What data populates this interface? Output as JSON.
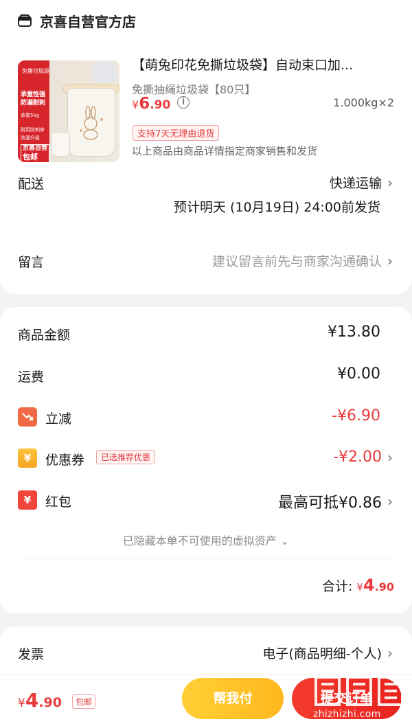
{
  "shop": {
    "icon": "store-icon",
    "name": "京喜自营官方店"
  },
  "product": {
    "image": {
      "banner_top": "免撕垃圾袋",
      "banner_line1": "承重性强",
      "banner_line2": "防漏耐刺",
      "small1": "承重5kg",
      "small2": "耐用防刺穿",
      "small3": "防漏升级",
      "badge_line1": "京喜自营",
      "badge_line2": "包邮"
    },
    "title": "【萌兔印花免撕垃圾袋】自动束口加...",
    "spec": "免撕抽绳垃圾袋【80只】",
    "price_symbol": "¥",
    "price_int": "6",
    "price_dec": ".90",
    "weight_qty": "1.000kg×2",
    "return_policy": "支持7天无理由退货",
    "seller_note": "以上商品由商品详情指定商家销售和发货"
  },
  "delivery": {
    "label": "配送",
    "method": "快递运输",
    "eta": "预计明天 (10月19日) 24:00前发货"
  },
  "message": {
    "label": "留言",
    "placeholder": "建议留言前先与商家沟通确认"
  },
  "amounts": {
    "goods_label": "商品金额",
    "goods_value": "¥13.80",
    "shipping_label": "运费",
    "shipping_value": "¥0.00",
    "discount_label": "立减",
    "discount_value": "-¥6.90",
    "coupon_label": "优惠券",
    "coupon_tag": "已选推荐优惠",
    "coupon_value": "-¥2.00",
    "redpacket_label": "红包",
    "redpacket_value": "最高可抵¥0.86",
    "hidden_assets": "已隐藏本单不可使用的虚拟资产 ⌄",
    "total_label": "合计:",
    "total_symbol": "¥",
    "total_int": "4",
    "total_dec": ".90"
  },
  "invoice": {
    "label": "发票",
    "value": "电子(商品明细-个人)"
  },
  "bottom_bar": {
    "price_symbol": "¥",
    "price_int": "4",
    "price_dec": ".90",
    "shipping_tag": "包邮",
    "pay_help_label": "帮我付",
    "submit_label": "提交订单"
  },
  "watermark": {
    "text": "值 什么值得买",
    "url": "zhizhizhi.com"
  },
  "colors": {
    "accent_red": "#e93b3d",
    "pay_help_yellow": "#ffc02a",
    "submit_red": "#f0302a"
  }
}
